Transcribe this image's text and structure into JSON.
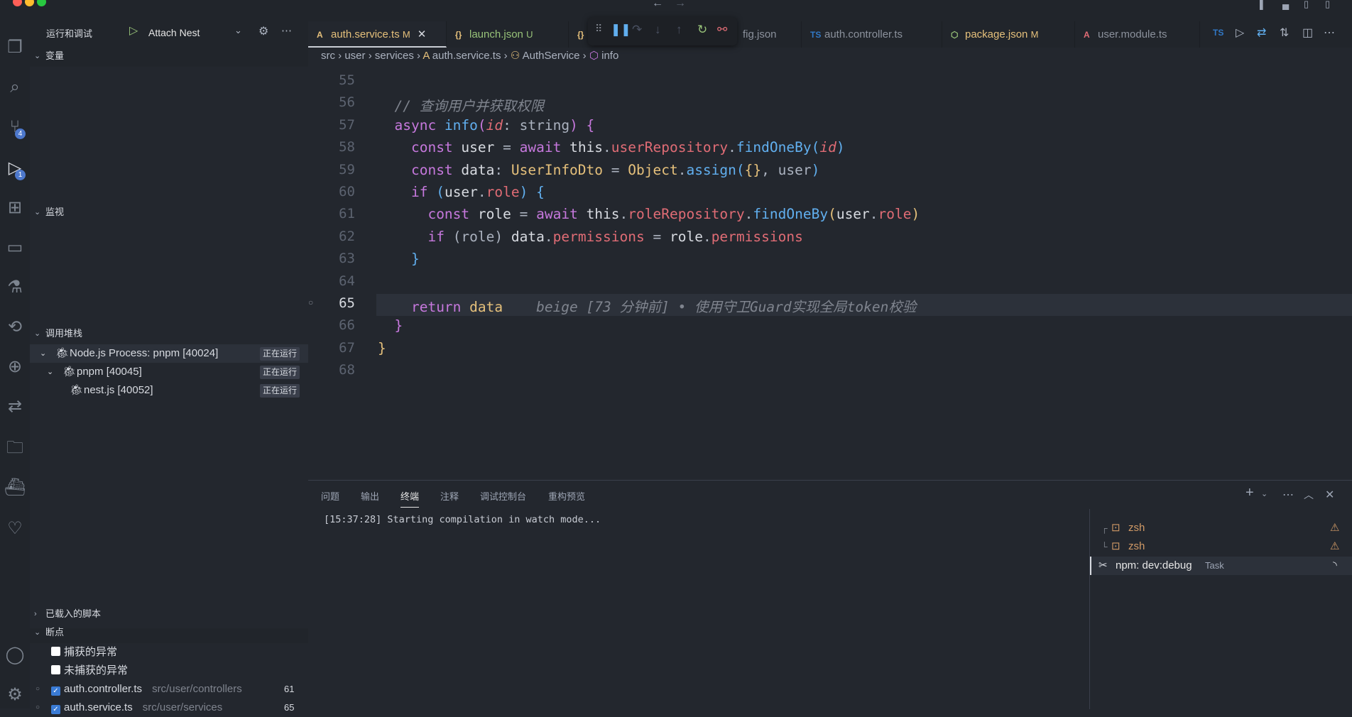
{
  "window": {
    "nav_back": "←",
    "nav_forward": "→"
  },
  "activity": {
    "scm_badge": "4",
    "debug_badge": "1"
  },
  "sidebar": {
    "title": "运行和调试",
    "config": "Attach Nest",
    "variables": "变量",
    "watch": "监视",
    "callstack": "调用堆栈",
    "threads": [
      {
        "label": "Node.js Process: pnpm [40024]",
        "status": "正在运行"
      },
      {
        "label": "pnpm [40045]",
        "status": "正在运行"
      },
      {
        "label": "nest.js [40052]",
        "status": "正在运行"
      }
    ],
    "loaded_scripts": "已载入的脚本",
    "breakpoints": "断点",
    "bp_items": [
      {
        "label": "捕获的异常",
        "checked": false
      },
      {
        "label": "未捕获的异常",
        "checked": false
      },
      {
        "label": "auth.controller.ts",
        "path": "src/user/controllers",
        "line": "61",
        "checked": true
      },
      {
        "label": "auth.service.ts",
        "path": "src/user/services",
        "line": "65",
        "checked": true
      }
    ]
  },
  "tabs": [
    {
      "label": "auth.service.ts",
      "status": "M",
      "active": true
    },
    {
      "label": "launch.json",
      "status": "U"
    },
    {
      "label": "fig.json"
    },
    {
      "label": "auth.controller.ts"
    },
    {
      "label": "package.json",
      "status": "M"
    },
    {
      "label": "user.module.ts"
    }
  ],
  "breadcrumb": [
    "src",
    "user",
    "services",
    "auth.service.ts",
    "AuthService",
    "info"
  ],
  "editor": {
    "current_line": "65",
    "lines": [
      {
        "n": "55",
        "t": []
      },
      {
        "n": "56",
        "t": [
          [
            "  ",
            ""
          ],
          [
            "// 查询用户并获取权限",
            "cm"
          ]
        ]
      },
      {
        "n": "57",
        "t": [
          [
            "  ",
            ""
          ],
          [
            "async ",
            "kw"
          ],
          [
            "info",
            "fn"
          ],
          [
            "(",
            "br2"
          ],
          [
            "id",
            "par"
          ],
          [
            ": string",
            ""
          ],
          [
            ") ",
            "br2"
          ],
          [
            "{",
            "br2"
          ]
        ]
      },
      {
        "n": "58",
        "t": [
          [
            "    ",
            ""
          ],
          [
            "const ",
            "kw"
          ],
          [
            "user",
            "var"
          ],
          [
            " = ",
            ""
          ],
          [
            "await ",
            "kw"
          ],
          [
            "this",
            "var"
          ],
          [
            ".",
            ""
          ],
          [
            "userRepository",
            "prop"
          ],
          [
            ".",
            ""
          ],
          [
            "findOneBy",
            "fn"
          ],
          [
            "(",
            "br3"
          ],
          [
            "id",
            "par"
          ],
          [
            ")",
            "br3"
          ]
        ]
      },
      {
        "n": "59",
        "t": [
          [
            "    ",
            ""
          ],
          [
            "const ",
            "kw"
          ],
          [
            "data",
            "var"
          ],
          [
            ": ",
            ""
          ],
          [
            "UserInfoDto",
            "ty"
          ],
          [
            " = ",
            ""
          ],
          [
            "Object",
            "ty"
          ],
          [
            ".",
            ""
          ],
          [
            "assign",
            "fn"
          ],
          [
            "(",
            "br3"
          ],
          [
            "{}",
            "br1"
          ],
          [
            ", user",
            ""
          ],
          [
            ")",
            "br3"
          ]
        ]
      },
      {
        "n": "60",
        "t": [
          [
            "    ",
            ""
          ],
          [
            "if ",
            "kw"
          ],
          [
            "(",
            "br3"
          ],
          [
            "user",
            "var"
          ],
          [
            ".",
            ""
          ],
          [
            "role",
            "prop"
          ],
          [
            ") ",
            "br3"
          ],
          [
            "{",
            "br3"
          ]
        ]
      },
      {
        "n": "61",
        "t": [
          [
            "      ",
            ""
          ],
          [
            "const ",
            "kw"
          ],
          [
            "role",
            "var"
          ],
          [
            " = ",
            ""
          ],
          [
            "await ",
            "kw"
          ],
          [
            "this",
            "var"
          ],
          [
            ".",
            ""
          ],
          [
            "roleRepository",
            "prop"
          ],
          [
            ".",
            ""
          ],
          [
            "findOneBy",
            "fn"
          ],
          [
            "(",
            "br1"
          ],
          [
            "user",
            "var"
          ],
          [
            ".",
            ""
          ],
          [
            "role",
            "prop"
          ],
          [
            ")",
            "br1"
          ]
        ]
      },
      {
        "n": "62",
        "t": [
          [
            "      ",
            ""
          ],
          [
            "if ",
            "kw"
          ],
          [
            "(role) ",
            ""
          ],
          [
            "data",
            "var"
          ],
          [
            ".",
            ""
          ],
          [
            "permissions",
            "prop"
          ],
          [
            " = ",
            ""
          ],
          [
            "role",
            "var"
          ],
          [
            ".",
            ""
          ],
          [
            "permissions",
            "prop"
          ]
        ]
      },
      {
        "n": "63",
        "t": [
          [
            "    ",
            ""
          ],
          [
            "}",
            "br3"
          ]
        ]
      },
      {
        "n": "64",
        "t": []
      },
      {
        "n": "65",
        "t": [
          [
            "    ",
            ""
          ],
          [
            "return ",
            "kw"
          ],
          [
            "data",
            "ty"
          ],
          [
            "    beige [73 分钟前] • 使用守卫Guard实现全局token校验",
            "blame"
          ]
        ]
      },
      {
        "n": "66",
        "t": [
          [
            "  ",
            ""
          ],
          [
            "}",
            "br2"
          ]
        ]
      },
      {
        "n": "67",
        "t": [
          [
            "}",
            "br1"
          ]
        ]
      },
      {
        "n": "68",
        "t": []
      }
    ]
  },
  "panel": {
    "tabs": [
      "问题",
      "输出",
      "终端",
      "注释",
      "调试控制台",
      "重构预览"
    ],
    "active_tab": "终端",
    "terminal_output": "[15:37:28] Starting compilation in watch mode...",
    "terminals": [
      {
        "label": "zsh"
      },
      {
        "label": "zsh"
      },
      {
        "label": "npm: dev:debug",
        "tag": "Task"
      }
    ]
  },
  "colors": {
    "accent": "#4d78cc",
    "modified": "#e5c07b",
    "untracked": "#98c379"
  }
}
